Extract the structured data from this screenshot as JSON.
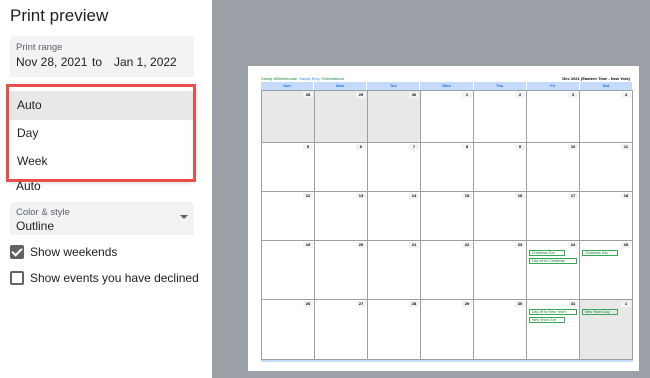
{
  "panel": {
    "title": "Print preview",
    "print_range": {
      "label": "Print range",
      "from": "Nov 28, 2021",
      "to_word": "to",
      "end": "Jan 1, 2022"
    },
    "menu_options": [
      "Auto",
      "Day",
      "Week"
    ],
    "selected_menu_index": 0,
    "scale_value": "Auto",
    "color_style": {
      "label": "Color & style",
      "value": "Outline"
    },
    "checkboxes": [
      {
        "label": "Show weekends",
        "checked": true
      },
      {
        "label": "Show events you have declined",
        "checked": false
      }
    ]
  },
  "preview": {
    "header_left": {
      "name": "Sandy Writtenhouse,",
      "sub1": "Sandy Eloy,",
      "sub2": "Celebrations"
    },
    "header_right": "Dec 2021 (Eastern Time - New York)",
    "weekdays": [
      "Sun",
      "Mon",
      "Tue",
      "Wed",
      "Thu",
      "Fri",
      "Sat"
    ],
    "weeks": [
      [
        {
          "d": "28",
          "other": true
        },
        {
          "d": "29",
          "other": true
        },
        {
          "d": "30",
          "other": true
        },
        {
          "d": "1"
        },
        {
          "d": "2"
        },
        {
          "d": "3"
        },
        {
          "d": "4"
        }
      ],
      [
        {
          "d": "5"
        },
        {
          "d": "6"
        },
        {
          "d": "7"
        },
        {
          "d": "8"
        },
        {
          "d": "9"
        },
        {
          "d": "10"
        },
        {
          "d": "11"
        }
      ],
      [
        {
          "d": "12"
        },
        {
          "d": "13"
        },
        {
          "d": "14"
        },
        {
          "d": "15"
        },
        {
          "d": "16"
        },
        {
          "d": "17"
        },
        {
          "d": "18"
        }
      ],
      [
        {
          "d": "19"
        },
        {
          "d": "20"
        },
        {
          "d": "21"
        },
        {
          "d": "22"
        },
        {
          "d": "23"
        },
        {
          "d": "24",
          "events": [
            "Christmas Eve",
            "Day off for Christmas"
          ]
        },
        {
          "d": "25",
          "events": [
            "Christmas Day"
          ]
        }
      ],
      [
        {
          "d": "26"
        },
        {
          "d": "27"
        },
        {
          "d": "28"
        },
        {
          "d": "29"
        },
        {
          "d": "30"
        },
        {
          "d": "31",
          "events": [
            "Day off for New Year's",
            "New Year's Eve"
          ]
        },
        {
          "d": "1",
          "other": true,
          "events": [
            "New Year's Day"
          ]
        }
      ]
    ],
    "colors": {
      "accent": "#1a73e8",
      "highlight_border": "#e5504c",
      "event": "#34a853"
    }
  }
}
